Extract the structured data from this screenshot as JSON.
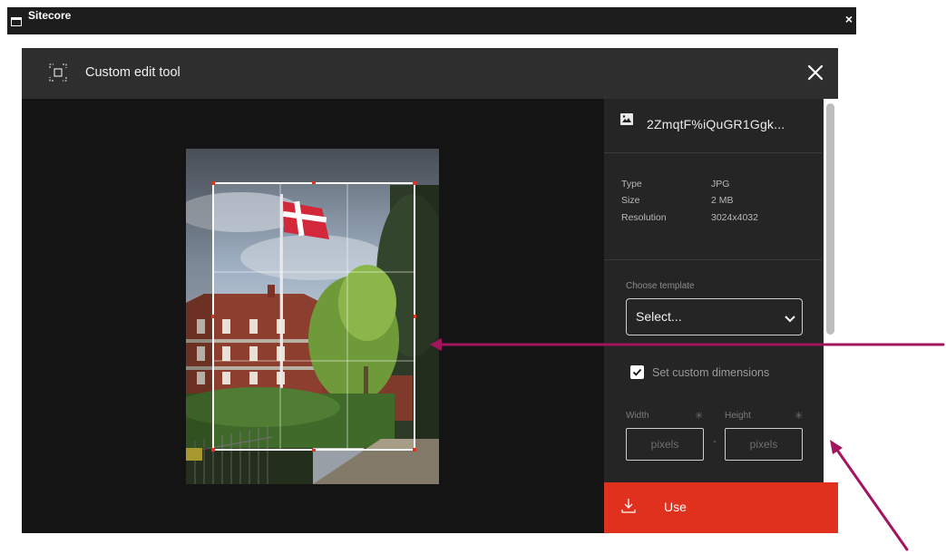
{
  "window": {
    "title": "Sitecore",
    "close_glyph": "×"
  },
  "dialog": {
    "title": "Custom edit tool",
    "file_name": "2ZmqtF%iQuGR1Ggk...",
    "meta": [
      {
        "label": "Type",
        "value": "JPG"
      },
      {
        "label": "Size",
        "value": "2 MB"
      },
      {
        "label": "Resolution",
        "value": "3024x4032"
      }
    ],
    "template": {
      "label": "Choose template",
      "value": "Select..."
    },
    "custom_dimensions": {
      "label": "Set custom dimensions",
      "checked": true
    },
    "width": {
      "label": "Width",
      "placeholder": "pixels",
      "required_mark": "✳"
    },
    "height": {
      "label": "Height",
      "placeholder": "pixels",
      "required_mark": "✳"
    },
    "dim_separator": "-",
    "use_button": "Use"
  },
  "colors": {
    "use_button": "#e0301e",
    "annotation_arrow": "#a3145f",
    "header": "#2e2e2e",
    "sidebar": "#252525"
  },
  "icons": [
    "window-icon",
    "crop-icon",
    "close-icon",
    "image-icon",
    "chevron-down-icon",
    "checkmark-icon",
    "download-icon"
  ]
}
